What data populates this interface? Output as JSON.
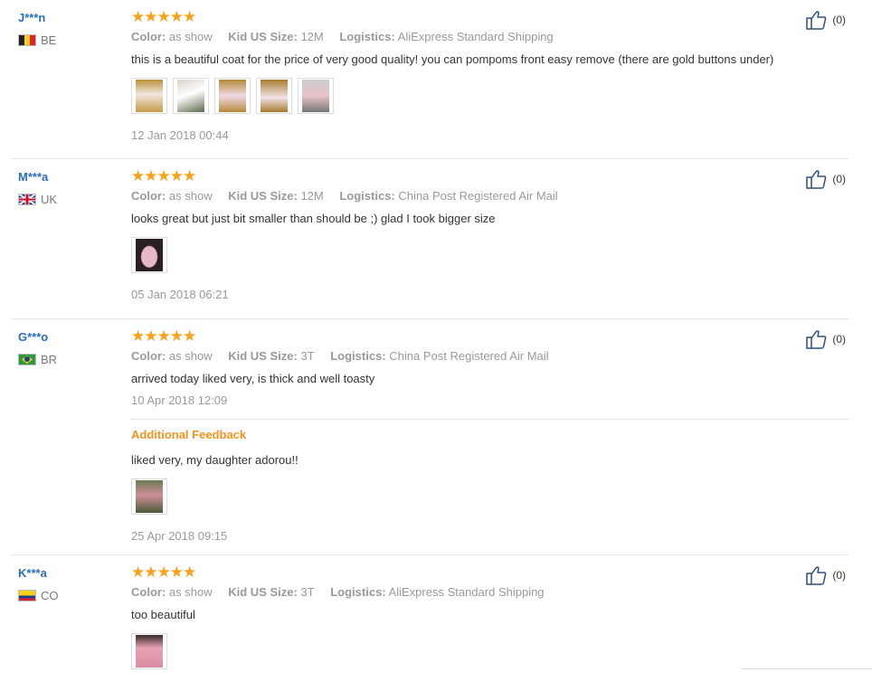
{
  "labels": {
    "color": "Color:",
    "size": "Kid US Size:",
    "logistics": "Logistics:",
    "additional": "Additional Feedback"
  },
  "reviews": [
    {
      "user": "J***n",
      "country": "BE",
      "stars": "★★★★★",
      "color": "as show",
      "size": "12M",
      "logistics": "AliExpress Standard Shipping",
      "text": "this is a beautiful coat for the price of very good quality! you can pompoms front easy remove (there are gold buttons under)",
      "photos": 5,
      "date": "12 Jan 2018 00:44",
      "likes": "(0)"
    },
    {
      "user": "M***a",
      "country": "UK",
      "stars": "★★★★★",
      "color": "as show",
      "size": "12M",
      "logistics": "China Post Registered Air Mail",
      "text": "looks great but just bit smaller than should be ;) glad I took bigger size",
      "photos": 1,
      "date": "05 Jan 2018 06:21",
      "likes": "(0)"
    },
    {
      "user": "G***o",
      "country": "BR",
      "stars": "★★★★★",
      "color": "as show",
      "size": "3T",
      "logistics": "China Post Registered Air Mail",
      "text": "arrived today liked very, is thick and well toasty",
      "date": "10 Apr 2018 12:09",
      "likes": "(0)",
      "additional_text": "liked very, my daughter adorou!!",
      "additional_photos": 1,
      "additional_date": "25 Apr 2018 09:15"
    },
    {
      "user": "K***a",
      "country": "CO",
      "stars": "★★★★★",
      "color": "as show",
      "size": "3T",
      "logistics": "AliExpress Standard Shipping",
      "text": "too beautiful",
      "photos": 1,
      "likes": "(0)"
    }
  ],
  "colors": {
    "username": "#2a6ebb",
    "stars": "#f7a21a",
    "additional_title": "#f7941d",
    "muted": "#999999"
  },
  "icons": {
    "like": "thumbs-up-icon",
    "photo": "review-photo"
  }
}
